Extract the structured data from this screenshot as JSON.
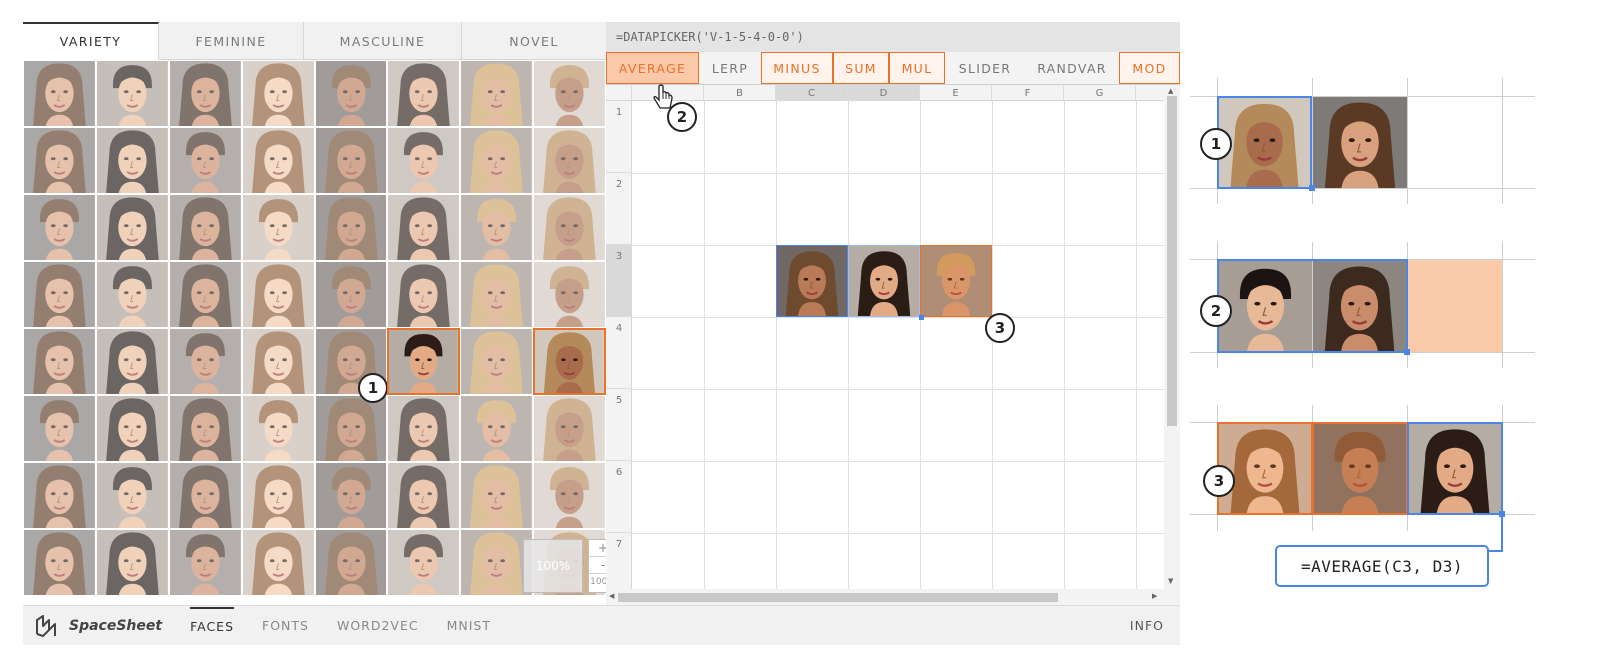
{
  "picker": {
    "tabs": [
      {
        "label": "VARIETY",
        "active": true
      },
      {
        "label": "FEMININE",
        "active": false
      },
      {
        "label": "MASCULINE",
        "active": false
      },
      {
        "label": "NOVEL",
        "active": false
      }
    ],
    "zoom_overlay": "100%",
    "zoom_in": "+",
    "zoom_out": "-",
    "zoom_level": "100%"
  },
  "sheet": {
    "formula": "=DATAPICKER('V-1-5-4-0-0')",
    "tools": [
      "AVERAGE",
      "LERP",
      "MINUS",
      "SUM",
      "MUL",
      "SLIDER",
      "RANDVAR",
      "MOD"
    ],
    "columns": [
      "",
      "B",
      "C",
      "D",
      "E",
      "F",
      "G"
    ],
    "rows": [
      "1",
      "2",
      "3",
      "4",
      "5",
      "6",
      "7"
    ]
  },
  "bottom_nav": {
    "app_name": "SpaceSheet",
    "items": [
      "FACES",
      "FONTS",
      "WORD2VEC",
      "MNIST"
    ],
    "info": "INFO"
  },
  "callouts": [
    "1",
    "2",
    "3"
  ],
  "illustration": {
    "labels": [
      "1",
      "2",
      "3"
    ],
    "formula": "=AVERAGE(C3, D3)"
  },
  "colors": {
    "accent_orange": "#e8722c",
    "selection_blue": "#4a86e8",
    "result_peach": "#fbcaa9"
  }
}
